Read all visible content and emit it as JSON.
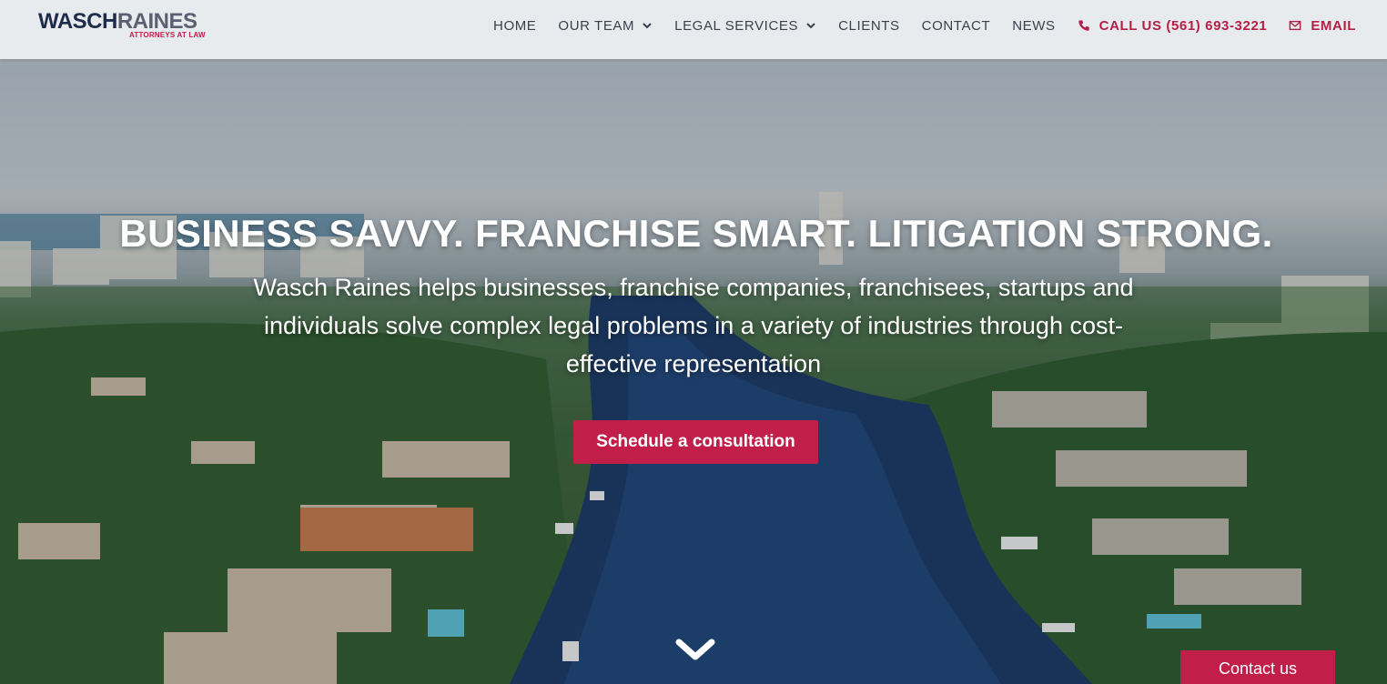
{
  "logo": {
    "primary": "WASCH",
    "secondary": "RAINES",
    "tagline": "ATTORNEYS AT LAW"
  },
  "nav": {
    "items": [
      {
        "label": "HOME"
      },
      {
        "label": "OUR TEAM",
        "has_dropdown": true
      },
      {
        "label": "LEGAL SERVICES",
        "has_dropdown": true
      },
      {
        "label": "CLIENTS"
      },
      {
        "label": "CONTACT"
      },
      {
        "label": "NEWS"
      }
    ],
    "call": {
      "label": "CALL US (561) 693-3221",
      "icon": "phone-icon"
    },
    "email": {
      "label": "EMAIL",
      "icon": "envelope-icon"
    }
  },
  "hero": {
    "title": "BUSINESS SAVVY. FRANCHISE SMART. LITIGATION STRONG.",
    "subtitle": "Wasch Raines helps businesses, franchise companies, franchisees, startups and individuals solve complex legal problems in a variety of industries through cost-effective representation",
    "cta_label": "Schedule a consultation",
    "scroll_icon": "chevron-down-icon"
  },
  "floating": {
    "contact_label": "Contact us"
  },
  "colors": {
    "accent": "#c11e4a",
    "navy": "#1f2b4d",
    "nav_text": "#3a3f48",
    "header_bg": "#e8ebee"
  }
}
